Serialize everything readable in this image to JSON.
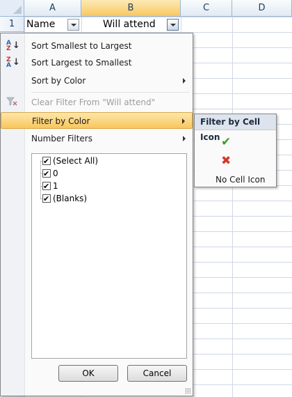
{
  "columns": [
    "A",
    "B",
    "C",
    "D"
  ],
  "row_numbers": [
    "1"
  ],
  "cells": {
    "a1": "Name",
    "b1": "Will attend"
  },
  "menu": {
    "sort_asc": "Sort Smallest to Largest",
    "sort_desc": "Sort Largest to Smallest",
    "sort_by_color": "Sort by Color",
    "clear_filter": "Clear Filter From \"Will attend\"",
    "filter_by_color": "Filter by Color",
    "number_filters": "Number Filters",
    "list_items": [
      "(Select All)",
      "0",
      "1",
      "(Blanks)"
    ],
    "ok": "OK",
    "cancel": "Cancel"
  },
  "submenu": {
    "header": "Filter by Cell Icon",
    "check_icon": "green-check-icon",
    "x_icon": "red-x-icon",
    "no_cell_icon": "No Cell Icon"
  },
  "colors": {
    "highlight": "#f9c65c",
    "header_blue": "#1e3c63",
    "check_green": "#3a9a2a",
    "x_red": "#d23a2a"
  }
}
